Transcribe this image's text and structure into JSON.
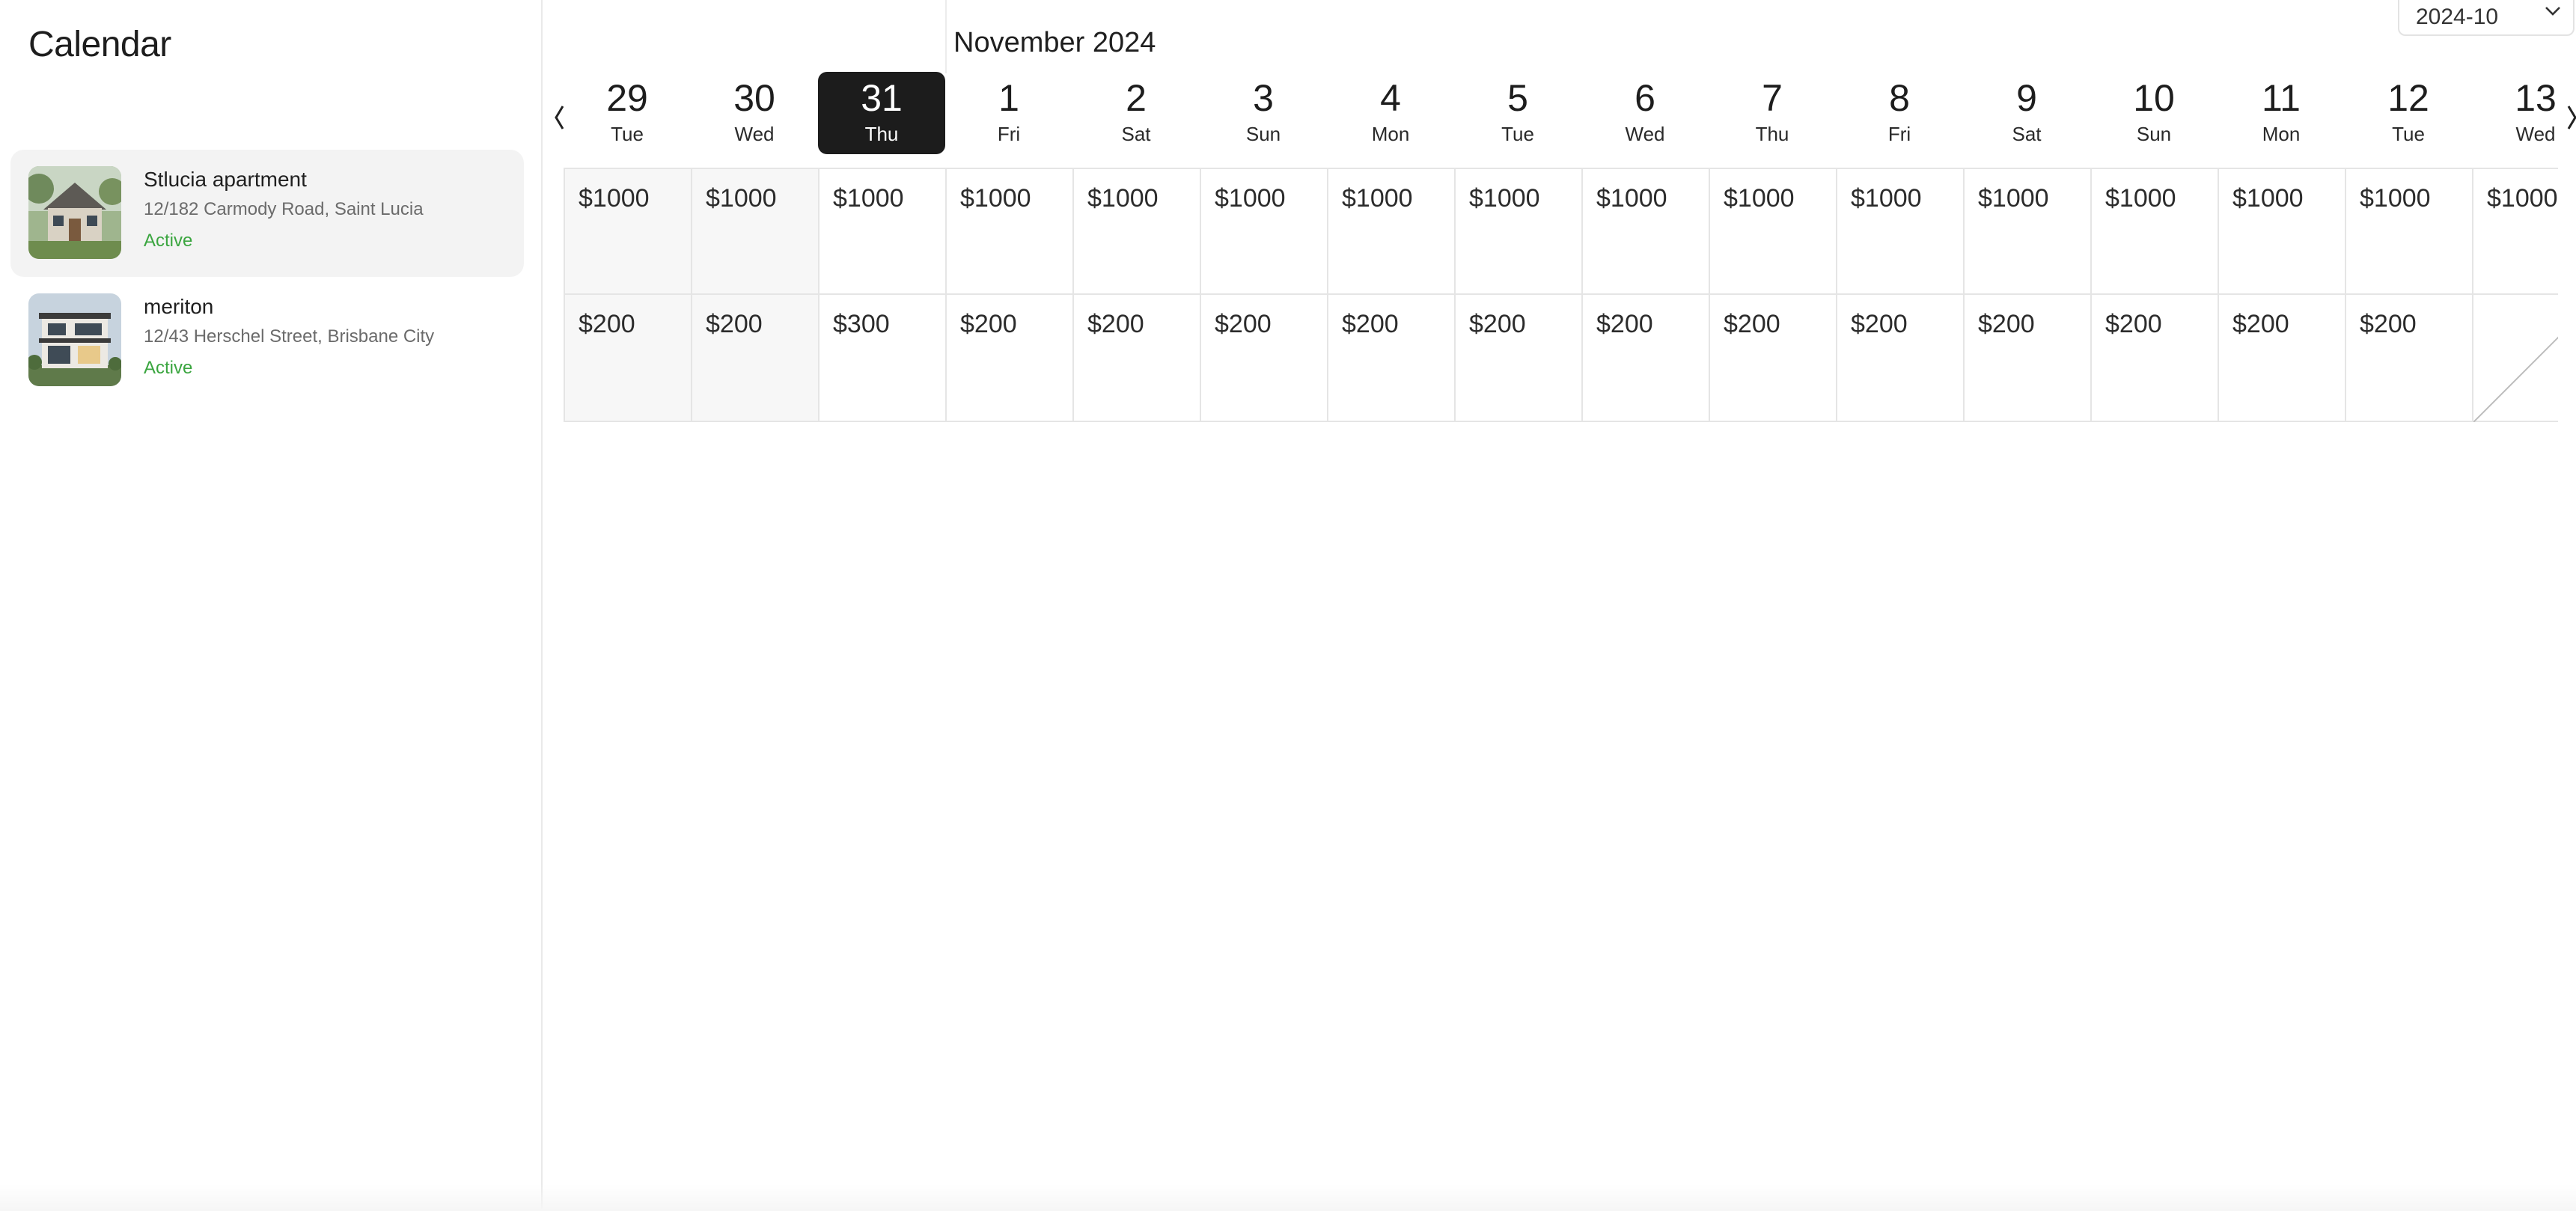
{
  "sidebar": {
    "title": "Calendar",
    "listings": [
      {
        "name": "Stlucia apartment",
        "address": "12/182 Carmody Road, Saint Lucia",
        "status": "Active"
      },
      {
        "name": "meriton",
        "address": "12/43 Herschel Street, Brisbane City",
        "status": "Active"
      }
    ]
  },
  "calendar": {
    "month_label": "November 2024",
    "month_select": "2024-10",
    "days": [
      {
        "num": "29",
        "weekday": "Tue"
      },
      {
        "num": "30",
        "weekday": "Wed"
      },
      {
        "num": "31",
        "weekday": "Thu"
      },
      {
        "num": "1",
        "weekday": "Fri"
      },
      {
        "num": "2",
        "weekday": "Sat"
      },
      {
        "num": "3",
        "weekday": "Sun"
      },
      {
        "num": "4",
        "weekday": "Mon"
      },
      {
        "num": "5",
        "weekday": "Tue"
      },
      {
        "num": "6",
        "weekday": "Wed"
      },
      {
        "num": "7",
        "weekday": "Thu"
      },
      {
        "num": "8",
        "weekday": "Fri"
      },
      {
        "num": "9",
        "weekday": "Sat"
      },
      {
        "num": "10",
        "weekday": "Sun"
      },
      {
        "num": "11",
        "weekday": "Mon"
      },
      {
        "num": "12",
        "weekday": "Tue"
      },
      {
        "num": "13",
        "weekday": "Wed"
      }
    ],
    "today_index": 2,
    "past_count": 2,
    "rows": [
      [
        "$1000",
        "$1000",
        "$1000",
        "$1000",
        "$1000",
        "$1000",
        "$1000",
        "$1000",
        "$1000",
        "$1000",
        "$1000",
        "$1000",
        "$1000",
        "$1000",
        "$1000",
        "$1000"
      ],
      [
        "$200",
        "$200",
        "$300",
        "$200",
        "$200",
        "$200",
        "$200",
        "$200",
        "$200",
        "$200",
        "$200",
        "$200",
        "$200",
        "$200",
        "$200",
        ""
      ]
    ]
  },
  "colors": {
    "accent_active": "#3aa53f",
    "today_bg": "#1c1c1c",
    "selected_row_bg": "#f3f3f3"
  }
}
